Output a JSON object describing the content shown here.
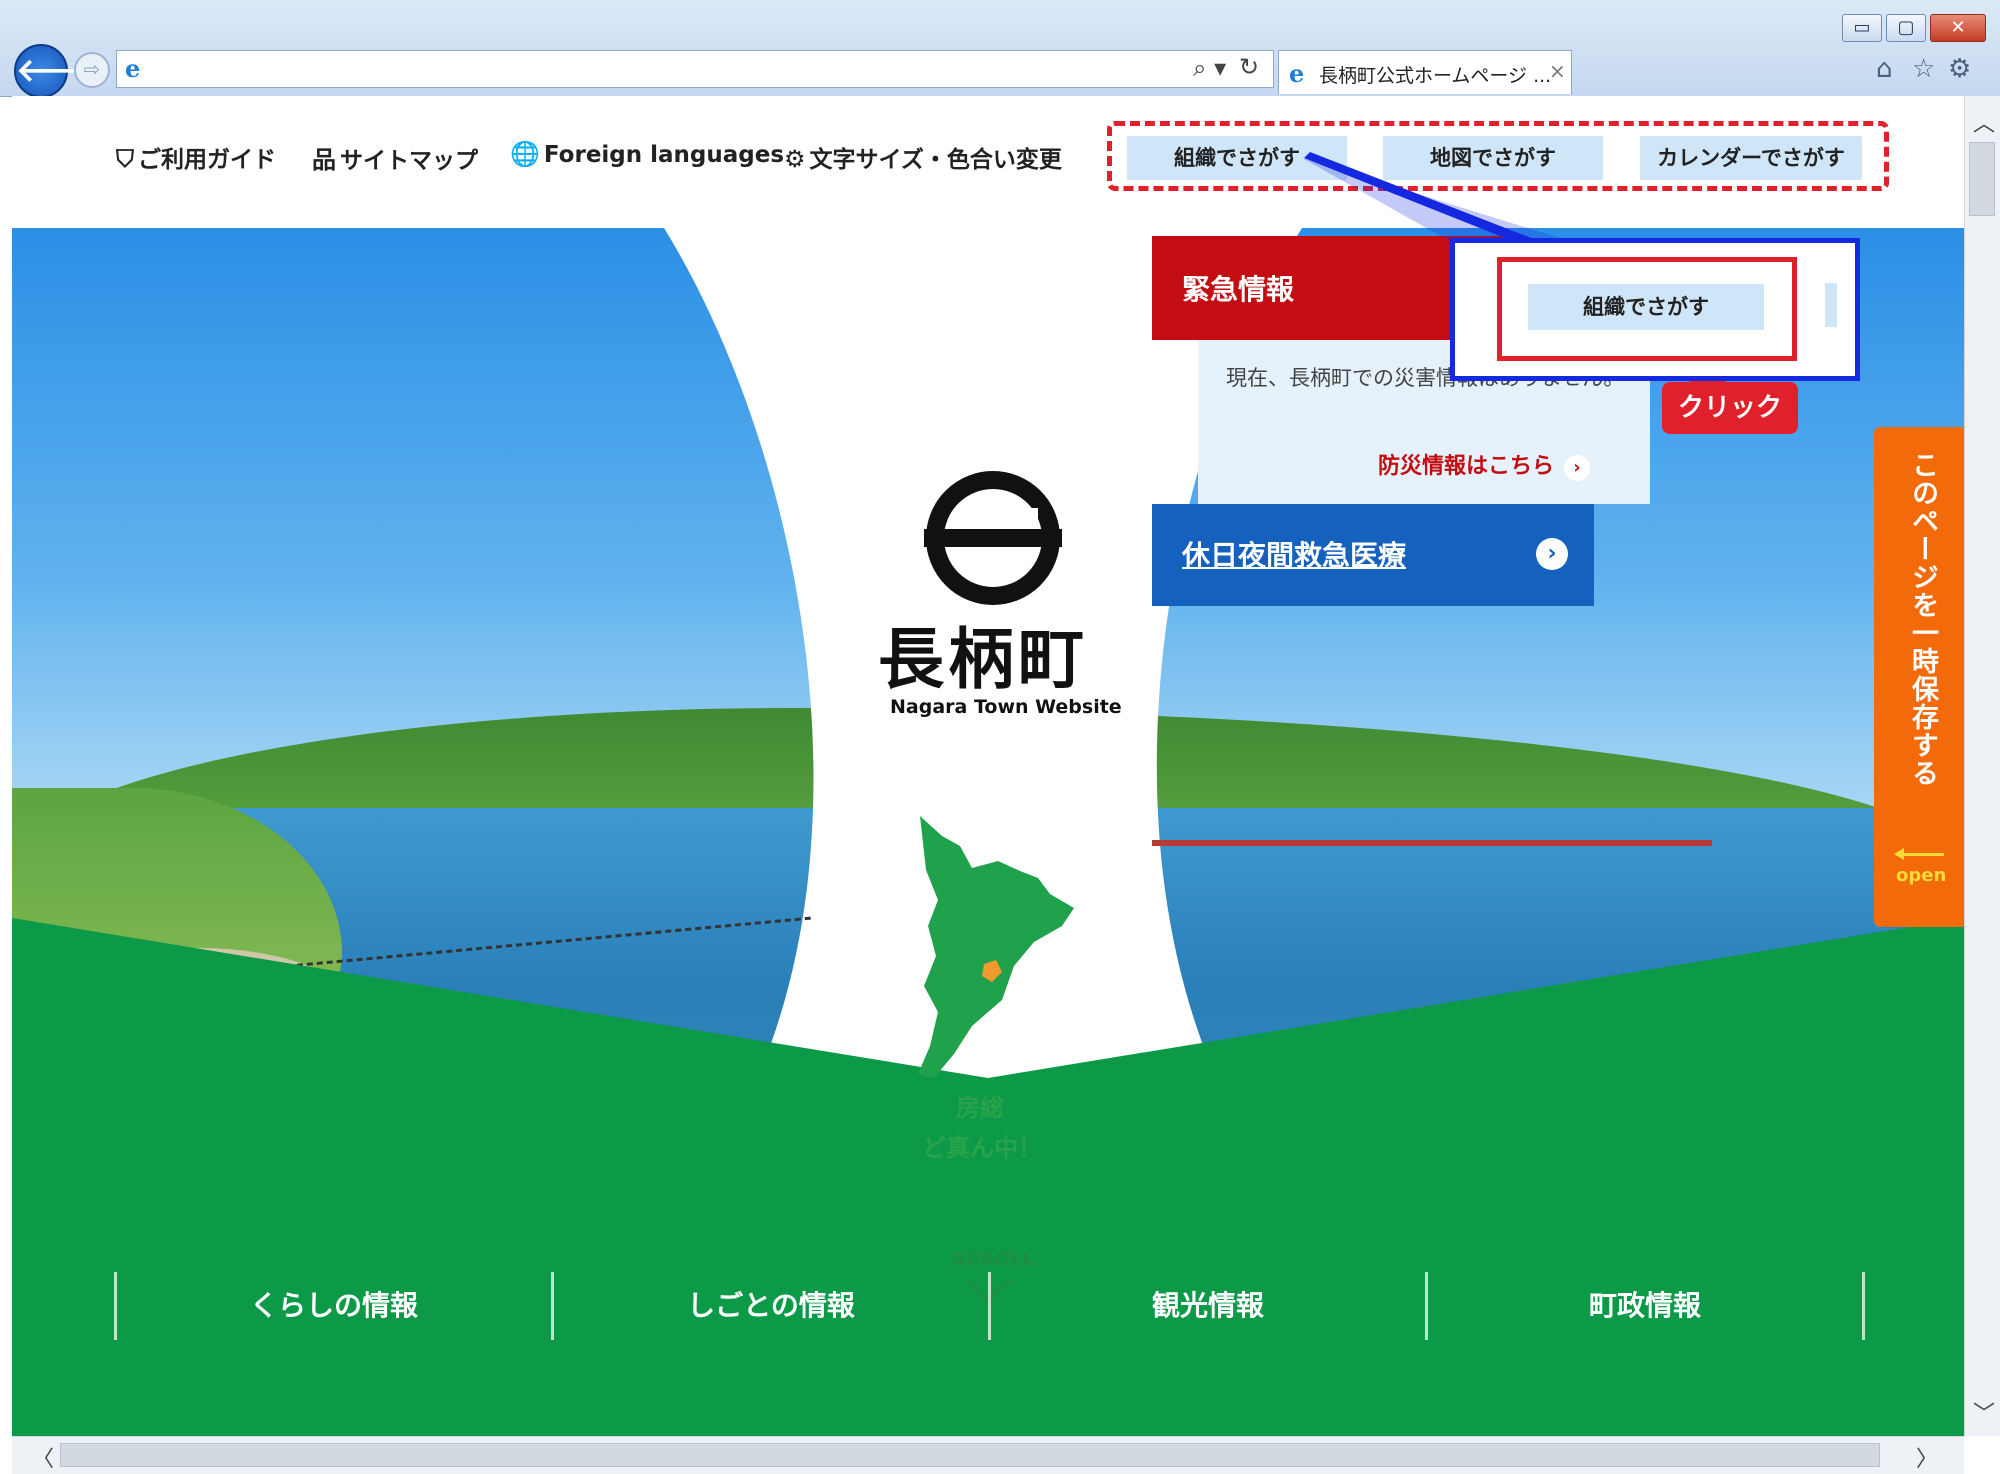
{
  "browser": {
    "window_buttons": {
      "minimize": "▭",
      "maximize": "▢",
      "close": "✕"
    },
    "back_glyph": "🡐",
    "forward_glyph": "⇨",
    "address_glyphs": {
      "ie": "e",
      "search": "⌕ ▾",
      "refresh": "↻"
    },
    "tab": {
      "icon": "e",
      "title": "長柄町公式ホームページ ...",
      "close": "×"
    },
    "tool_glyphs": {
      "home": "⌂",
      "favorites": "☆",
      "settings": "⚙"
    }
  },
  "utility_nav": {
    "items": [
      {
        "icon": "shield-icon",
        "glyph": "⛉",
        "label": "ご利用ガイド"
      },
      {
        "icon": "sitemap-icon",
        "glyph": "品",
        "label": "サイトマップ"
      },
      {
        "icon": "globe-icon",
        "glyph": "🌐",
        "label": "Foreign languages"
      },
      {
        "icon": "font-size-icon",
        "glyph": "⚙",
        "label": "文字サイズ・色合い変更"
      }
    ],
    "search_buttons": [
      "組織でさがす",
      "地図でさがす",
      "カレンダーでさがす"
    ]
  },
  "hero": {
    "town_name": "長柄町",
    "town_en": "Nagara Town  Website",
    "tagline_1": "房総",
    "tagline_2": "ど真ん中！",
    "scroll_label": "SCROLL"
  },
  "emergency": {
    "title": "緊急情報",
    "message": "現在、長柄町での災害情報はありません。",
    "link": "防災情報はこちら",
    "link_arrow": "›"
  },
  "clinic": {
    "label": "休日夜間救急医療",
    "arrow": "›"
  },
  "annotation": {
    "button": "組織でさがす",
    "click_label": "クリック"
  },
  "save_tab": {
    "text": "このページを一時保存する",
    "open": "open"
  },
  "main_menu": [
    "くらしの情報",
    "しごとの情報",
    "観光情報",
    "町政情報"
  ],
  "scrollbar_glyphs": {
    "up": "︿",
    "down": "﹀",
    "left": "〈",
    "right": "〉"
  },
  "colors": {
    "emergency_red": "#c40d12",
    "clinic_blue": "#1462bd",
    "menu_green": "#0d9a48",
    "save_orange": "#f26a0a",
    "search_button_bg": "#cfe6f9",
    "annotation_red": "#e0202a",
    "annotation_blue": "#1429e0"
  }
}
